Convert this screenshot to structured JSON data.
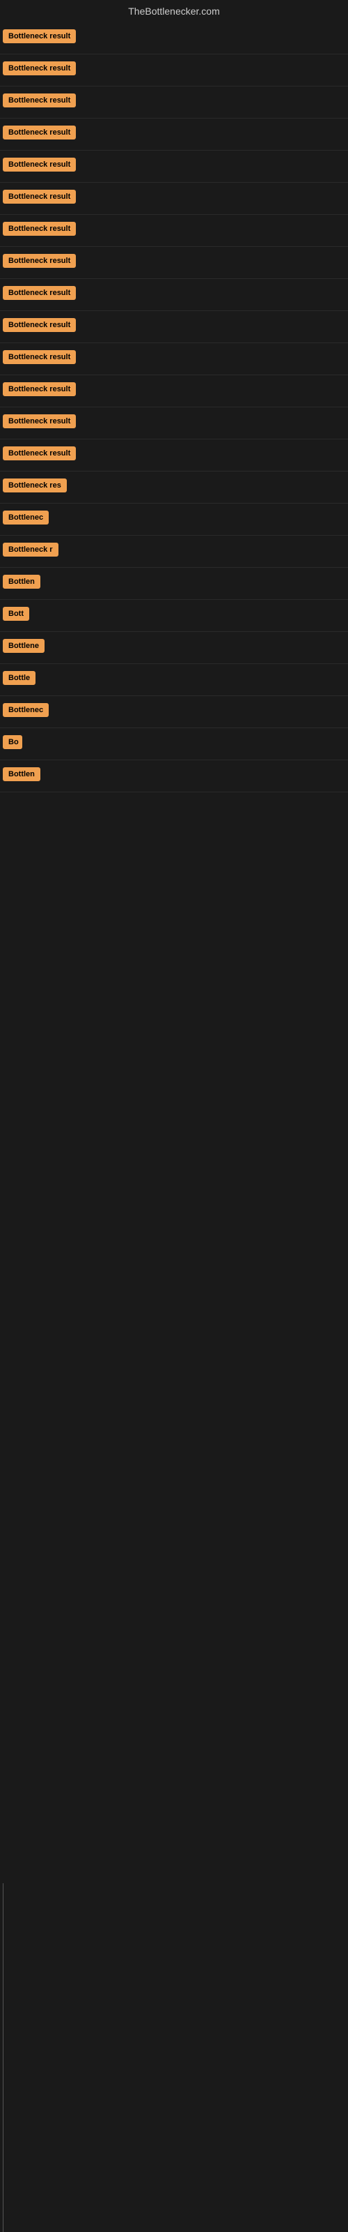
{
  "site": {
    "title": "TheBottlenecker.com"
  },
  "badges": [
    {
      "label": "Bottleneck result",
      "width": "full"
    },
    {
      "label": "Bottleneck result",
      "width": "full"
    },
    {
      "label": "Bottleneck result",
      "width": "full"
    },
    {
      "label": "Bottleneck result",
      "width": "full"
    },
    {
      "label": "Bottleneck result",
      "width": "full"
    },
    {
      "label": "Bottleneck result",
      "width": "full"
    },
    {
      "label": "Bottleneck result",
      "width": "full"
    },
    {
      "label": "Bottleneck result",
      "width": "full"
    },
    {
      "label": "Bottleneck result",
      "width": "full"
    },
    {
      "label": "Bottleneck result",
      "width": "full"
    },
    {
      "label": "Bottleneck result",
      "width": "full"
    },
    {
      "label": "Bottleneck result",
      "width": "full"
    },
    {
      "label": "Bottleneck result",
      "width": "full"
    },
    {
      "label": "Bottleneck result",
      "width": "full"
    },
    {
      "label": "Bottleneck res",
      "width": "partial"
    },
    {
      "label": "Bottlenec",
      "width": "partial2"
    },
    {
      "label": "Bottleneck r",
      "width": "partial3"
    },
    {
      "label": "Bottlen",
      "width": "partial4"
    },
    {
      "label": "Bott",
      "width": "partial5"
    },
    {
      "label": "Bottlene",
      "width": "partial6"
    },
    {
      "label": "Bottle",
      "width": "partial7"
    },
    {
      "label": "Bottlenec",
      "width": "partial8"
    },
    {
      "label": "Bo",
      "width": "partial9"
    },
    {
      "label": "Bottlen",
      "width": "partial10"
    }
  ]
}
